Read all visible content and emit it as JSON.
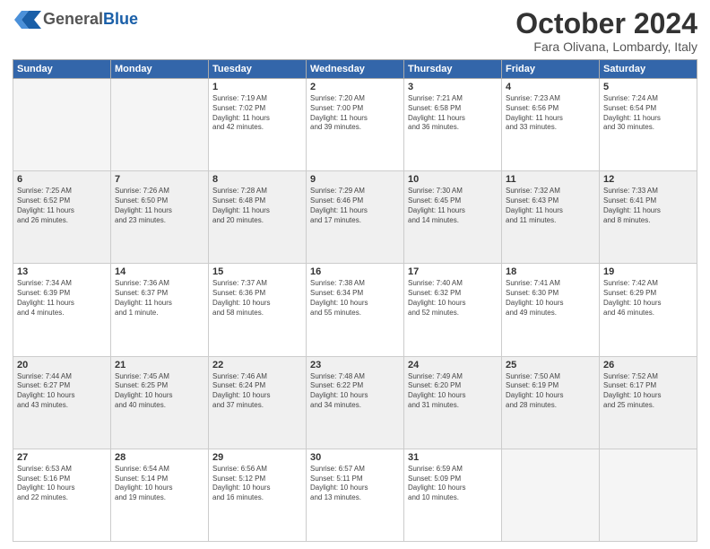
{
  "header": {
    "logo_general": "General",
    "logo_blue": "Blue",
    "month_title": "October 2024",
    "location": "Fara Olivana, Lombardy, Italy"
  },
  "days_of_week": [
    "Sunday",
    "Monday",
    "Tuesday",
    "Wednesday",
    "Thursday",
    "Friday",
    "Saturday"
  ],
  "weeks": [
    [
      {
        "day": "",
        "info": ""
      },
      {
        "day": "",
        "info": ""
      },
      {
        "day": "1",
        "info": "Sunrise: 7:19 AM\nSunset: 7:02 PM\nDaylight: 11 hours\nand 42 minutes."
      },
      {
        "day": "2",
        "info": "Sunrise: 7:20 AM\nSunset: 7:00 PM\nDaylight: 11 hours\nand 39 minutes."
      },
      {
        "day": "3",
        "info": "Sunrise: 7:21 AM\nSunset: 6:58 PM\nDaylight: 11 hours\nand 36 minutes."
      },
      {
        "day": "4",
        "info": "Sunrise: 7:23 AM\nSunset: 6:56 PM\nDaylight: 11 hours\nand 33 minutes."
      },
      {
        "day": "5",
        "info": "Sunrise: 7:24 AM\nSunset: 6:54 PM\nDaylight: 11 hours\nand 30 minutes."
      }
    ],
    [
      {
        "day": "6",
        "info": "Sunrise: 7:25 AM\nSunset: 6:52 PM\nDaylight: 11 hours\nand 26 minutes."
      },
      {
        "day": "7",
        "info": "Sunrise: 7:26 AM\nSunset: 6:50 PM\nDaylight: 11 hours\nand 23 minutes."
      },
      {
        "day": "8",
        "info": "Sunrise: 7:28 AM\nSunset: 6:48 PM\nDaylight: 11 hours\nand 20 minutes."
      },
      {
        "day": "9",
        "info": "Sunrise: 7:29 AM\nSunset: 6:46 PM\nDaylight: 11 hours\nand 17 minutes."
      },
      {
        "day": "10",
        "info": "Sunrise: 7:30 AM\nSunset: 6:45 PM\nDaylight: 11 hours\nand 14 minutes."
      },
      {
        "day": "11",
        "info": "Sunrise: 7:32 AM\nSunset: 6:43 PM\nDaylight: 11 hours\nand 11 minutes."
      },
      {
        "day": "12",
        "info": "Sunrise: 7:33 AM\nSunset: 6:41 PM\nDaylight: 11 hours\nand 8 minutes."
      }
    ],
    [
      {
        "day": "13",
        "info": "Sunrise: 7:34 AM\nSunset: 6:39 PM\nDaylight: 11 hours\nand 4 minutes."
      },
      {
        "day": "14",
        "info": "Sunrise: 7:36 AM\nSunset: 6:37 PM\nDaylight: 11 hours\nand 1 minute."
      },
      {
        "day": "15",
        "info": "Sunrise: 7:37 AM\nSunset: 6:36 PM\nDaylight: 10 hours\nand 58 minutes."
      },
      {
        "day": "16",
        "info": "Sunrise: 7:38 AM\nSunset: 6:34 PM\nDaylight: 10 hours\nand 55 minutes."
      },
      {
        "day": "17",
        "info": "Sunrise: 7:40 AM\nSunset: 6:32 PM\nDaylight: 10 hours\nand 52 minutes."
      },
      {
        "day": "18",
        "info": "Sunrise: 7:41 AM\nSunset: 6:30 PM\nDaylight: 10 hours\nand 49 minutes."
      },
      {
        "day": "19",
        "info": "Sunrise: 7:42 AM\nSunset: 6:29 PM\nDaylight: 10 hours\nand 46 minutes."
      }
    ],
    [
      {
        "day": "20",
        "info": "Sunrise: 7:44 AM\nSunset: 6:27 PM\nDaylight: 10 hours\nand 43 minutes."
      },
      {
        "day": "21",
        "info": "Sunrise: 7:45 AM\nSunset: 6:25 PM\nDaylight: 10 hours\nand 40 minutes."
      },
      {
        "day": "22",
        "info": "Sunrise: 7:46 AM\nSunset: 6:24 PM\nDaylight: 10 hours\nand 37 minutes."
      },
      {
        "day": "23",
        "info": "Sunrise: 7:48 AM\nSunset: 6:22 PM\nDaylight: 10 hours\nand 34 minutes."
      },
      {
        "day": "24",
        "info": "Sunrise: 7:49 AM\nSunset: 6:20 PM\nDaylight: 10 hours\nand 31 minutes."
      },
      {
        "day": "25",
        "info": "Sunrise: 7:50 AM\nSunset: 6:19 PM\nDaylight: 10 hours\nand 28 minutes."
      },
      {
        "day": "26",
        "info": "Sunrise: 7:52 AM\nSunset: 6:17 PM\nDaylight: 10 hours\nand 25 minutes."
      }
    ],
    [
      {
        "day": "27",
        "info": "Sunrise: 6:53 AM\nSunset: 5:16 PM\nDaylight: 10 hours\nand 22 minutes."
      },
      {
        "day": "28",
        "info": "Sunrise: 6:54 AM\nSunset: 5:14 PM\nDaylight: 10 hours\nand 19 minutes."
      },
      {
        "day": "29",
        "info": "Sunrise: 6:56 AM\nSunset: 5:12 PM\nDaylight: 10 hours\nand 16 minutes."
      },
      {
        "day": "30",
        "info": "Sunrise: 6:57 AM\nSunset: 5:11 PM\nDaylight: 10 hours\nand 13 minutes."
      },
      {
        "day": "31",
        "info": "Sunrise: 6:59 AM\nSunset: 5:09 PM\nDaylight: 10 hours\nand 10 minutes."
      },
      {
        "day": "",
        "info": ""
      },
      {
        "day": "",
        "info": ""
      }
    ]
  ]
}
